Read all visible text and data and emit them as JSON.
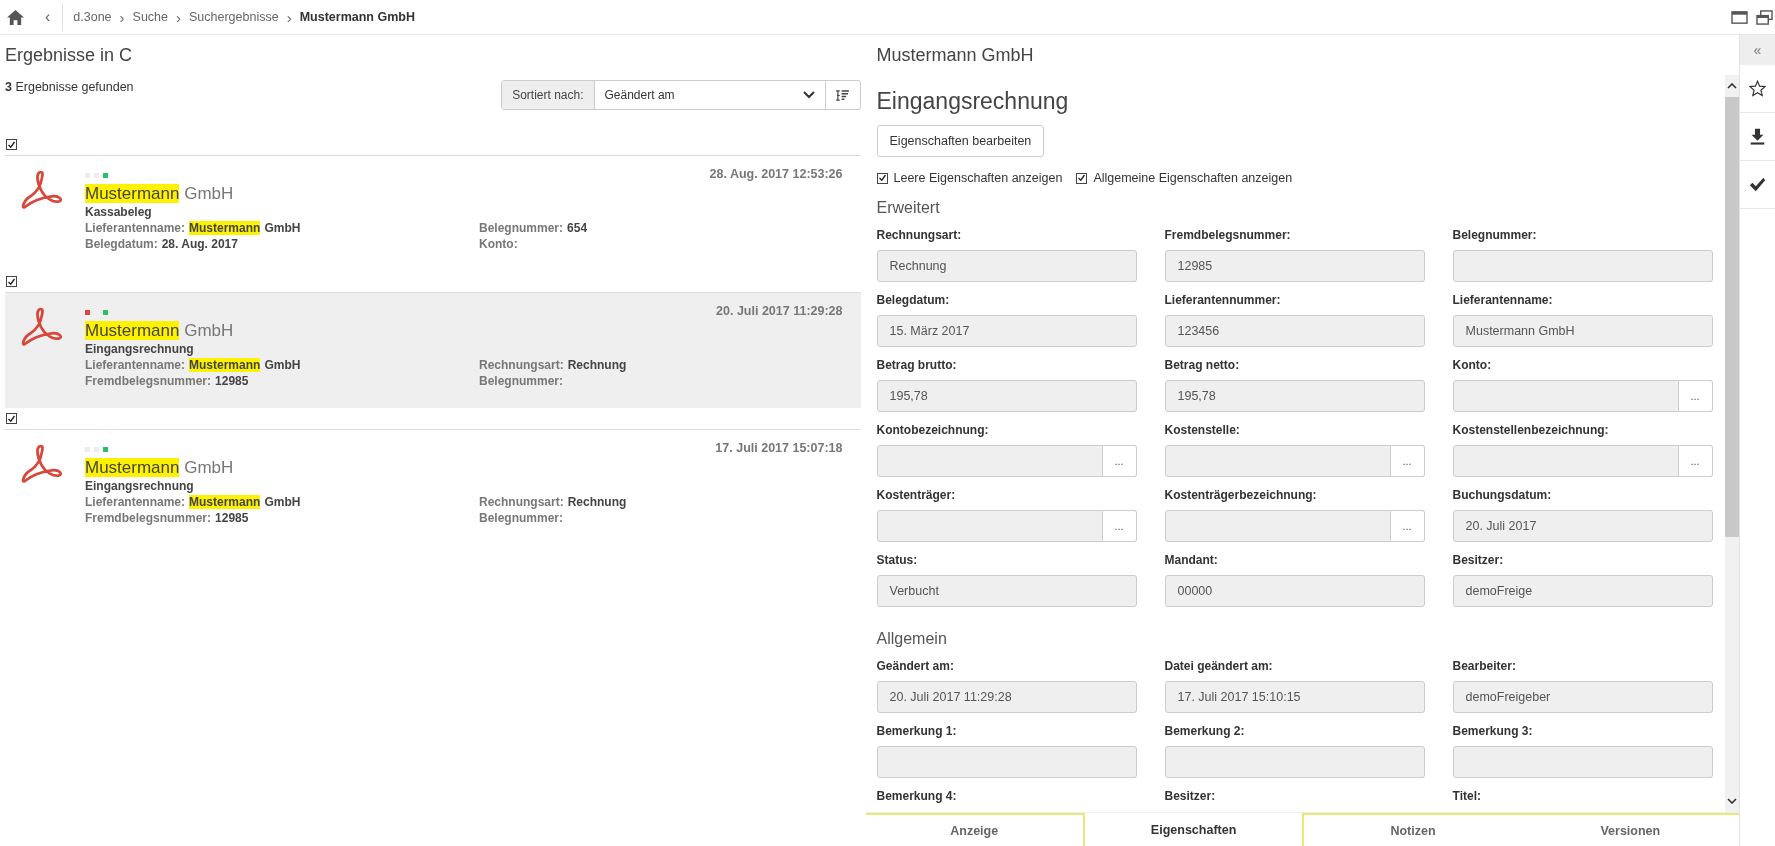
{
  "breadcrumb": {
    "back": "‹",
    "separator": "›",
    "items": [
      {
        "label": "d.3one",
        "current": false
      },
      {
        "label": "Suche",
        "current": false
      },
      {
        "label": "Suchergebnisse",
        "current": false
      },
      {
        "label": "Mustermann GmbH",
        "current": true
      }
    ]
  },
  "results": {
    "heading": "Ergebnisse in C",
    "count": "3",
    "count_label": "Ergebnisse gefunden",
    "sort": {
      "label": "Sortiert nach:",
      "value": "Geändert am"
    },
    "items": [
      {
        "checked": true,
        "selected": false,
        "status_dots": [
          {
            "kind": "dot",
            "color": "#ececf2"
          },
          {
            "kind": "dot",
            "color": "#ececf2"
          },
          {
            "kind": "dot",
            "color": "#2ebd6b"
          }
        ],
        "date": "28. Aug. 2017 12:53:26",
        "title_highlight": "Mustermann",
        "title_rest": "GmbH",
        "type": "Kassabeleg",
        "fields": [
          {
            "label": "Lieferantenname:",
            "highlight": "Mustermann",
            "value": "GmbH"
          },
          {
            "label": "Belegnummer:",
            "value": "654"
          },
          {
            "label": "Belegdatum:",
            "value": "28. Aug. 2017"
          },
          {
            "label": "Konto:"
          }
        ]
      },
      {
        "checked": true,
        "selected": true,
        "status_dots": [
          {
            "kind": "dot",
            "color": "#e0473a"
          },
          {
            "kind": "gap"
          },
          {
            "kind": "dot",
            "color": "#2ebd6b"
          }
        ],
        "date": "20. Juli 2017 11:29:28",
        "title_highlight": "Mustermann",
        "title_rest": "GmbH",
        "type": "Eingangsrechnung",
        "fields": [
          {
            "label": "Lieferantenname:",
            "highlight": "Mustermann",
            "value": "GmbH"
          },
          {
            "label": "Rechnungsart:",
            "value": "Rechnung"
          },
          {
            "label": "Fremdbelegsnummer:",
            "value": "12985"
          },
          {
            "label": "Belegnummer:"
          }
        ]
      },
      {
        "checked": true,
        "selected": false,
        "status_dots": [
          {
            "kind": "dot",
            "color": "#ececf2"
          },
          {
            "kind": "dot",
            "color": "#ececf2"
          },
          {
            "kind": "dot",
            "color": "#2ebd6b"
          }
        ],
        "date": "17. Juli 2017 15:07:18",
        "title_highlight": "Mustermann",
        "title_rest": "GmbH",
        "type": "Eingangsrechnung",
        "fields": [
          {
            "label": "Lieferantenname:",
            "highlight": "Mustermann",
            "value": "GmbH"
          },
          {
            "label": "Rechnungsart:",
            "value": "Rechnung"
          },
          {
            "label": "Fremdbelegsnummer:",
            "value": "12985"
          },
          {
            "label": "Belegnummer:"
          }
        ]
      }
    ]
  },
  "details": {
    "title": "Mustermann GmbH",
    "doc_type": "Eingangsrechnung",
    "edit_button": "Eigenschaften bearbeiten",
    "options": [
      {
        "label": "Leere Eigenschaften anzeigen",
        "checked": true
      },
      {
        "label": "Allgemeine Eigenschaften anzeigen",
        "checked": true
      }
    ],
    "sections": [
      {
        "title": "Erweitert",
        "fields": [
          {
            "kind": "text",
            "label": "Rechnungsart:",
            "value": "Rechnung"
          },
          {
            "kind": "text",
            "label": "Fremdbelegsnummer:",
            "value": "12985"
          },
          {
            "kind": "text",
            "label": "Belegnummer:"
          },
          {
            "kind": "text",
            "label": "Belegdatum:",
            "value": "15. März 2017"
          },
          {
            "kind": "text",
            "label": "Lieferantennummer:",
            "value": "123456"
          },
          {
            "kind": "text",
            "label": "Lieferantenname:",
            "value": "Mustermann GmbH"
          },
          {
            "kind": "text",
            "label": "Betrag brutto:",
            "value": "195,78"
          },
          {
            "kind": "text",
            "label": "Betrag netto:",
            "value": "195,78"
          },
          {
            "kind": "picker",
            "label": "Konto:",
            "button": "..."
          },
          {
            "kind": "picker",
            "label": "Kontobezeichnung:",
            "button": "..."
          },
          {
            "kind": "picker",
            "label": "Kostenstelle:",
            "button": "..."
          },
          {
            "kind": "picker",
            "label": "Kostenstellenbezeichnung:",
            "button": "..."
          },
          {
            "kind": "picker",
            "label": "Kostenträger:",
            "button": "..."
          },
          {
            "kind": "picker",
            "label": "Kostenträgerbezeichnung:",
            "button": "..."
          },
          {
            "kind": "text",
            "label": "Buchungsdatum:",
            "value": "20. Juli 2017"
          },
          {
            "kind": "text",
            "label": "Status:",
            "value": "Verbucht"
          },
          {
            "kind": "text",
            "label": "Mandant:",
            "value": "00000"
          },
          {
            "kind": "text",
            "label": "Besitzer:",
            "value": "demoFreige"
          }
        ]
      },
      {
        "title": "Allgemein",
        "fields": [
          {
            "kind": "text",
            "label": "Geändert am:",
            "value": "20. Juli 2017 11:29:28"
          },
          {
            "kind": "text",
            "label": "Datei geändert am:",
            "value": "17. Juli 2017 15:10:15"
          },
          {
            "kind": "text",
            "label": "Bearbeiter:",
            "value": "demoFreigeber"
          },
          {
            "kind": "text",
            "label": "Bemerkung 1:"
          },
          {
            "kind": "text",
            "label": "Bemerkung 2:"
          },
          {
            "kind": "text",
            "label": "Bemerkung 3:"
          },
          {
            "kind": "cut",
            "label": "Bemerkung 4:"
          },
          {
            "kind": "cut",
            "label": "Besitzer:"
          },
          {
            "kind": "cut",
            "label": "Titel:"
          }
        ]
      }
    ],
    "tabs": [
      {
        "label": "Anzeige",
        "selected": false
      },
      {
        "label": "Eigenschaften",
        "selected": true
      },
      {
        "label": "Notizen",
        "selected": false
      },
      {
        "label": "Versionen",
        "selected": false
      }
    ]
  },
  "rail": {
    "toggle": "«"
  }
}
